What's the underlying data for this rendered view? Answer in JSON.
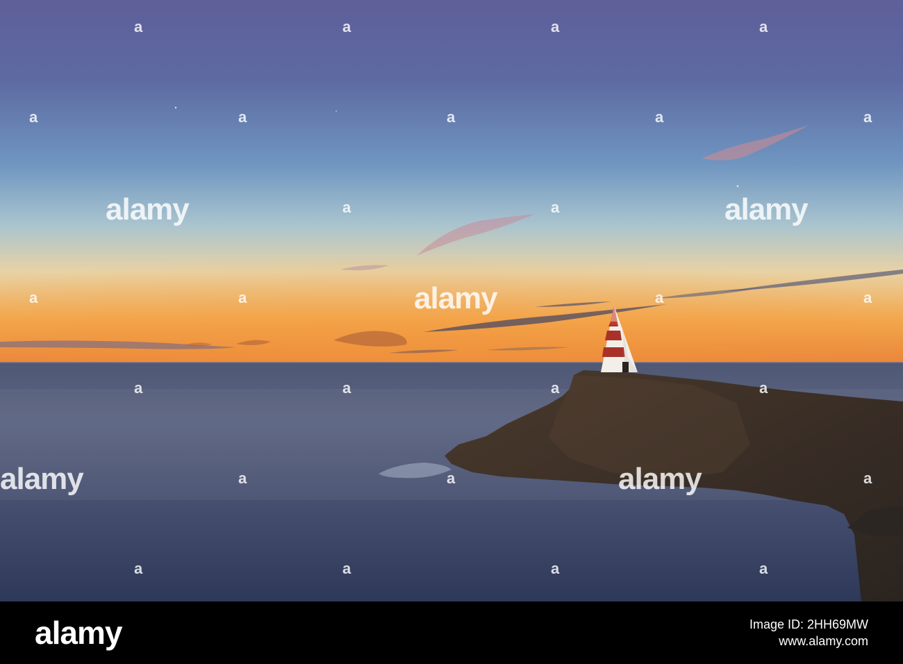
{
  "watermark": {
    "brand": "alamy",
    "mark": "a"
  },
  "footer": {
    "brand": "alamy",
    "image_id": "Image ID: 2HH69MW",
    "url": "www.alamy.com"
  },
  "colors": {
    "sky_top": "#5f6aa3",
    "sky_mid": "#8aa8c8",
    "horizon_glow": "#f4a040",
    "sea": "#3c4868",
    "rock": "#3a2e26",
    "obelisk_red": "#a8322a",
    "obelisk_white": "#f2efe8",
    "footer_bg": "#000000"
  }
}
